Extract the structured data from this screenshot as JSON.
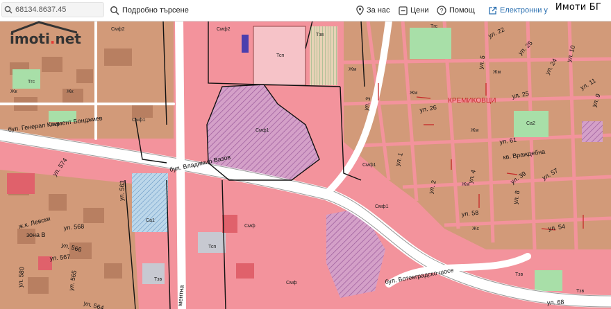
{
  "toolbar": {
    "coords": "68134.8637.45",
    "search": "Подробно търсене",
    "about": "За нас",
    "prices": "Цени",
    "help": "Помощ",
    "electronic": "Електронни у",
    "brand": "Имоти БГ"
  },
  "logo": {
    "pre": "imoti",
    "dot": ".",
    "post": "net"
  },
  "map": {
    "streets": [
      "бул. Генерал Климент Бонджиев",
      "бул. Владимир Вазов",
      "бул. Ботевградско шосе",
      "ул. 574",
      "ул. 563",
      "ул. 568",
      "ул. 566",
      "ул. 567",
      "ул. 580",
      "ул. 565",
      "ул. 564",
      "ул. 57",
      "ул. 22",
      "ул. 25",
      "ул. 24",
      "ул. 10",
      "ул. 11",
      "ул. 9",
      "ул. 26",
      "ул. 61",
      "ул. 39",
      "ул. 58",
      "ул. 54",
      "ул. 68",
      "кв. Враждебна",
      "ул. 1",
      "ул. 2",
      "ул. 3",
      "ул. 4",
      "ул. 8",
      "ул. 5",
      "ментна",
      "ж.к. Левски",
      "зона В"
    ],
    "district": "КРЕМИКОВЦИ",
    "zones": [
      "Смф2",
      "Смф2",
      "Смф1",
      "Смф1",
      "Смф1",
      "Смф1",
      "Смф",
      "Смф",
      "Тсп",
      "Тзв",
      "Тзв",
      "Тзв",
      "Тзв",
      "Тгс",
      "Тгс",
      "Жм",
      "Жм",
      "Жм",
      "Жм",
      "Жм",
      "Жк",
      "Жк",
      "Жс",
      "Са1",
      "Са2",
      "Тсп",
      "Смф"
    ]
  },
  "colors": {
    "mixed": "#f28a95",
    "residential": "#d6a07c",
    "green": "#a8dfa8",
    "road": "#ffffff"
  }
}
